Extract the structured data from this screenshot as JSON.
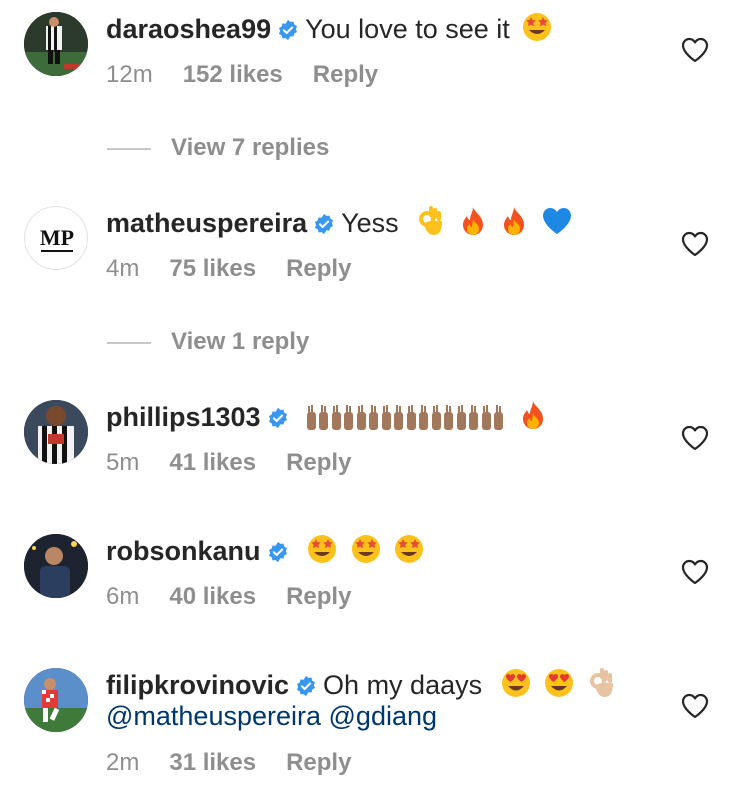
{
  "comments": [
    {
      "username": "daraoshea99",
      "text": "You love to see it",
      "emojis": [
        "star-struck"
      ],
      "time": "12m",
      "likes": "152 likes",
      "reply": "Reply",
      "view_replies": "View 7 replies"
    },
    {
      "username": "matheuspereira",
      "text": "Yess",
      "emojis": [
        "ok-hand",
        "fire",
        "fire",
        "blue-heart"
      ],
      "avatar_text": "MP",
      "time": "4m",
      "likes": "75 likes",
      "reply": "Reply",
      "view_replies": "View 1 reply"
    },
    {
      "username": "phillips1303",
      "text": "",
      "emojis": [
        "raising-hands",
        "raising-hands",
        "raising-hands",
        "raising-hands",
        "raising-hands",
        "raising-hands",
        "raising-hands",
        "raising-hands",
        "fire"
      ],
      "time": "5m",
      "likes": "41 likes",
      "reply": "Reply"
    },
    {
      "username": "robsonkanu",
      "text": "",
      "emojis": [
        "star-struck",
        "star-struck",
        "star-struck"
      ],
      "time": "6m",
      "likes": "40 likes",
      "reply": "Reply"
    },
    {
      "username": "filipkrovinovic",
      "text": "Oh my daays",
      "emojis": [
        "heart-eyes",
        "heart-eyes",
        "ok-hand"
      ],
      "mentions": "@matheuspereira @gdiang",
      "time": "2m",
      "likes": "31 likes",
      "reply": "Reply"
    }
  ],
  "colors": {
    "verified": "#3897f0",
    "muted": "#8e8e8e",
    "mention": "#00376b",
    "text": "#262626"
  }
}
